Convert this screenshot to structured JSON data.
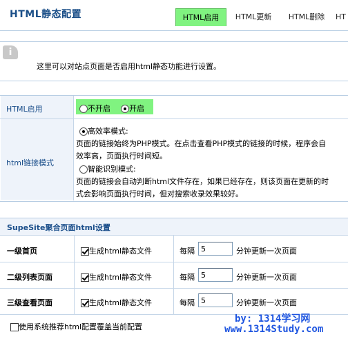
{
  "header": {
    "title": "HTML静态配置",
    "tabs": [
      {
        "label": "HTML启用",
        "active": true
      },
      {
        "label": "HTML更新",
        "active": false
      },
      {
        "label": "HTML删除",
        "active": false
      },
      {
        "label": "HT",
        "active": false
      }
    ]
  },
  "info": {
    "icon": "info-icon",
    "text": "这里可以对站点页面是否启用html静态功能进行设置。"
  },
  "settings": {
    "enable": {
      "label": "HTML启用",
      "options": [
        {
          "label": "不开启",
          "checked": false
        },
        {
          "label": "开启",
          "checked": true
        }
      ],
      "highlight_color": "#80f380"
    },
    "link_mode": {
      "label": "html链接模式",
      "options": [
        {
          "label": "高效率模式:",
          "checked": true,
          "desc_line1": "页面的链接始终为PHP模式。在点击查看PHP模式的链接的时候，程序会自",
          "desc_line2": "效率高，页面执行时间短。"
        },
        {
          "label": "智能识别模式:",
          "checked": false,
          "desc_line1": "页面的链接会自动判断html文件存在，如果已经存在，则该页面在更新的时",
          "desc_line2": "式会影响页面执行时间，但对搜索收录效果较好。"
        }
      ]
    }
  },
  "supesite": {
    "title": "SupeSite聚合页面html设置",
    "rows": [
      {
        "label": "一级首页",
        "checkbox_label": "生成html静态文件",
        "checked": true,
        "interval_label": "每隔",
        "interval_value": "5",
        "unit": "分钟更新一次页面"
      },
      {
        "label": "二级列表页面",
        "checkbox_label": "生成html静态文件",
        "checked": true,
        "interval_label": "每隔",
        "interval_value": "5",
        "unit": "分钟更新一次页面"
      },
      {
        "label": "三级查看页面",
        "checkbox_label": "生成html静态文件",
        "checked": true,
        "interval_label": "每隔",
        "interval_value": "5",
        "unit": "分钟更新一次页面"
      }
    ],
    "use_recommended": {
      "label": "使用系统推荐html配置覆盖当前配置",
      "checked": false
    }
  },
  "watermark": {
    "line1": "by: 1314学习网",
    "line2": "www.1314Study.com",
    "color": "#1e55e0"
  }
}
